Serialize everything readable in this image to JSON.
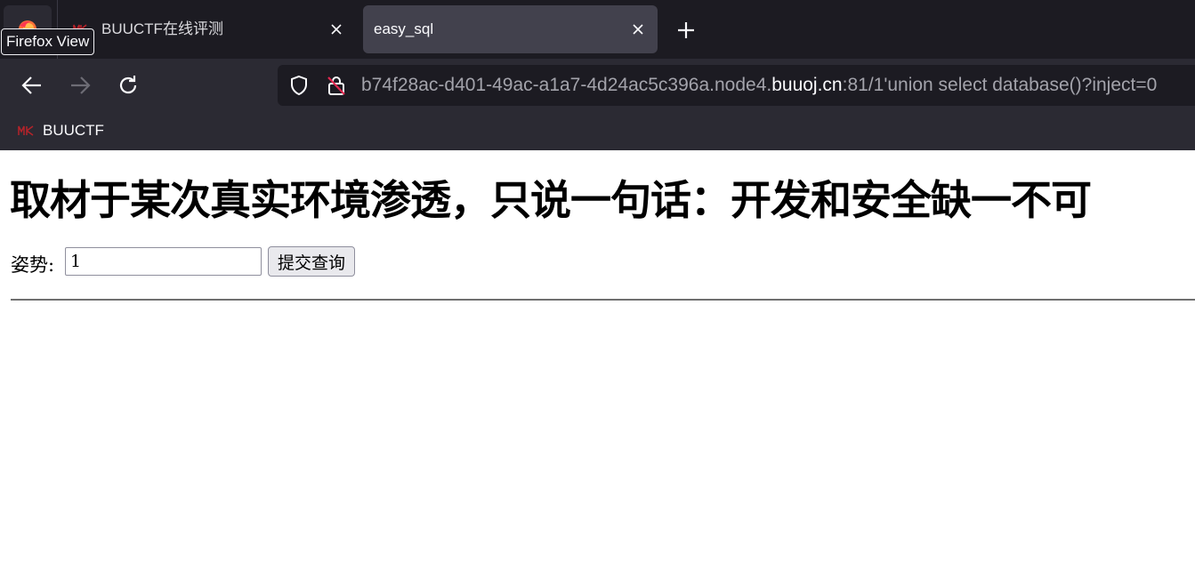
{
  "browser": {
    "tooltip": "Firefox View",
    "tabs": [
      {
        "title": "BUUCTF在线评测",
        "active": false
      },
      {
        "title": "easy_sql",
        "active": true
      }
    ],
    "url": {
      "prefix": "b74f28ac-d401-49ac-a1a7-4d24ac5c396a.node4.",
      "domain": "buuoj.cn",
      "suffix": ":81/1'union select database()?inject=0"
    },
    "bookmarks": [
      {
        "label": "BUUCTF"
      }
    ]
  },
  "page": {
    "title": "取材于某次真实环境渗透，只说一句话：开发和安全缺一不可",
    "form": {
      "label": "姿势:",
      "input_value": "1",
      "submit_label": "提交查询"
    }
  },
  "colors": {
    "chrome_bg": "#1c1b22",
    "toolbar_bg": "#2b2a33",
    "active_tab_bg": "#42414d",
    "favicon_red": "#b4232a"
  },
  "icons": [
    "firefox-view-icon",
    "tab-favicon-icon",
    "close-icon",
    "plus-icon",
    "back-arrow-icon",
    "forward-arrow-icon",
    "reload-icon",
    "shield-icon",
    "insecure-lock-icon"
  ]
}
